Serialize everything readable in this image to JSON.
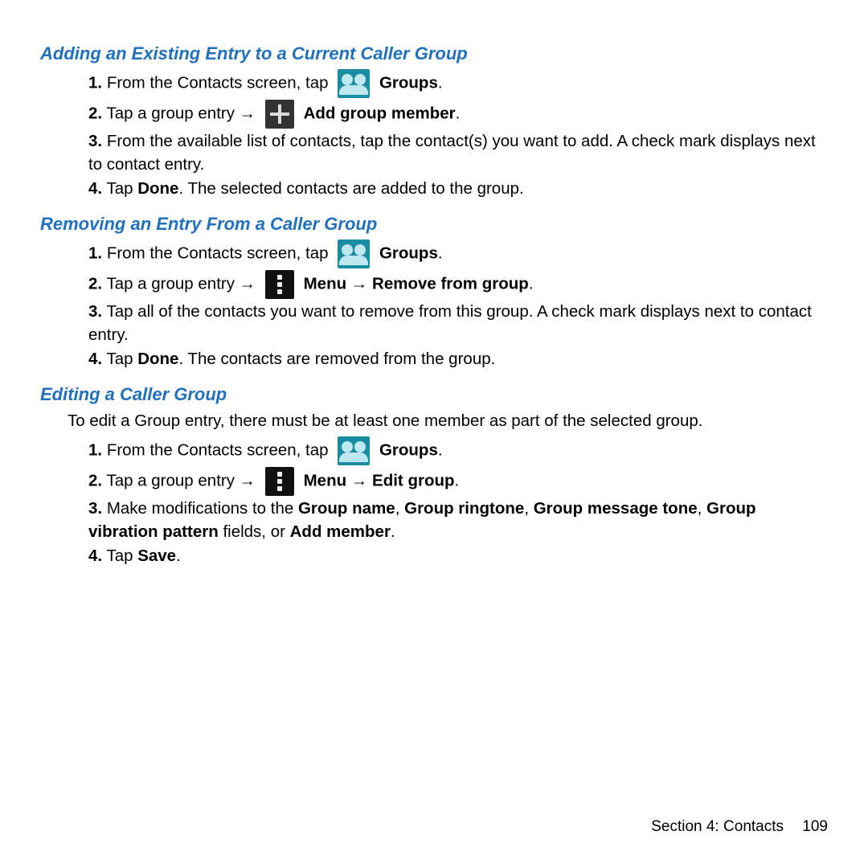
{
  "section1": {
    "heading": "Adding an Existing Entry to a Current Caller Group",
    "items": [
      {
        "pre": "From the Contacts screen, tap",
        "post": "Groups",
        "postsuffix": "."
      },
      {
        "pre": "Tap a group entry →",
        "post": "Add group member",
        "postsuffix": "."
      },
      {
        "textA": "From the available list of contacts, tap the contact(s) you want to add. A check mark displays next to contact entry."
      },
      {
        "textA": "Tap ",
        "bold": "Done",
        "textB": ". The selected contacts are added to the group."
      }
    ]
  },
  "section2": {
    "heading": "Removing an Entry From a Caller Group",
    "items": [
      {
        "pre": "From the Contacts screen, tap",
        "post": "Groups",
        "postsuffix": "."
      },
      {
        "pre": "Tap a group entry →",
        "post1": "Menu",
        "mid": " → ",
        "post2": "Remove from group",
        "postsuffix": "."
      },
      {
        "textA": "Tap all of the contacts you want to remove from this group. A check mark displays next to contact entry."
      },
      {
        "textA": "Tap ",
        "bold": "Done",
        "textB": ". The contacts are removed from the group."
      }
    ]
  },
  "section3": {
    "heading": "Editing a Caller Group",
    "intro": "To edit a Group entry, there must be at least one member as part of the selected group.",
    "items": [
      {
        "pre": "From the Contacts screen, tap",
        "post": "Groups",
        "postsuffix": "."
      },
      {
        "pre": "Tap a group entry →",
        "post1": "Menu",
        "mid": " → ",
        "post2": "Edit group",
        "postsuffix": "."
      },
      {
        "textA": "Make modifications to the ",
        "bold1": "Group name",
        "c1": ", ",
        "bold2": "Group ringtone",
        "c2": ", ",
        "bold3": "Group message tone",
        "c3": ", ",
        "bold4": "Group vibration pattern",
        "textB": " fields, or ",
        "bold5": "Add member",
        "textC": "."
      },
      {
        "textA": "Tap ",
        "bold": "Save",
        "textB": "."
      }
    ]
  },
  "footer": {
    "section": "Section 4:  Contacts",
    "page": "109"
  }
}
